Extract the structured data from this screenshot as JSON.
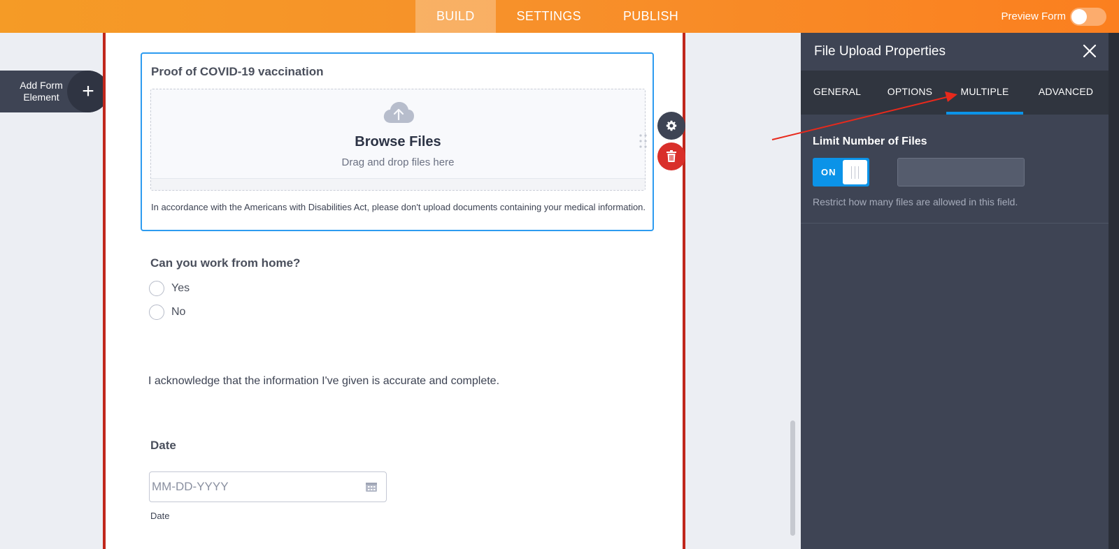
{
  "topbar": {
    "tabs": [
      {
        "label": "BUILD",
        "active": true
      },
      {
        "label": "SETTINGS",
        "active": false
      },
      {
        "label": "PUBLISH",
        "active": false
      }
    ],
    "preview_label": "Preview Form"
  },
  "add_element": {
    "label": "Add Form Element"
  },
  "form": {
    "upload_field": {
      "question": "Proof of COVID-19 vaccination",
      "browse_label": "Browse Files",
      "drag_label": "Drag and drop files here",
      "sublabel": "In accordance with the Americans with Disabilities Act, please don't upload documents containing your medical information."
    },
    "work_question": "Can you work from home?",
    "options": [
      "Yes",
      "No"
    ],
    "acknowledge": "I acknowledge that the information I've given is accurate and complete.",
    "date_label": "Date",
    "date_placeholder": "MM-DD-YYYY",
    "date_sublabel": "Date"
  },
  "panel": {
    "title": "File Upload Properties",
    "tabs": [
      {
        "label": "GENERAL",
        "active": false
      },
      {
        "label": "OPTIONS",
        "active": false
      },
      {
        "label": "MULTIPLE",
        "active": true
      },
      {
        "label": "ADVANCED",
        "active": false
      }
    ],
    "section_title": "Limit Number of Files",
    "toggle_label": "ON",
    "limit_value": "",
    "hint": "Restrict how many files are allowed in this field."
  },
  "colors": {
    "accent": "#0b93e8",
    "brand": "#f7902a",
    "danger": "#d92f2a",
    "annotation": "#e8291c"
  }
}
